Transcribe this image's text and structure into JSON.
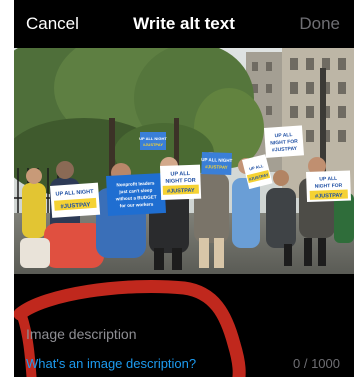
{
  "header": {
    "cancel_label": "Cancel",
    "title": "Write alt text",
    "done_label": "Done"
  },
  "photo": {
    "signs": {
      "sign1": "UP ALL NIGHT FOR #JUSTPAY",
      "sign2": "Nonprofit leaders just can't sleep without a BUDGET for our workers",
      "sign3": "UP ALL NIGHT FOR #JUSTPAY",
      "sign4": "UP ALL NIGHT FOR #JUSTPAY",
      "sign5": "UP ALL NIGHT FOR #JUSTPAY",
      "sign6": "UP ALL NIGHT FOR #JUSTPAY",
      "sign7": "UP ALL NIGHT FOR #JUSTPAY"
    }
  },
  "description": {
    "placeholder": "Image description",
    "value": "",
    "help_link": "What's an image description?",
    "counter": "0 / 1000"
  },
  "colors": {
    "background": "#000000",
    "link": "#1d9bf0",
    "muted": "#6e6e73",
    "scribble": "#c0281d"
  }
}
